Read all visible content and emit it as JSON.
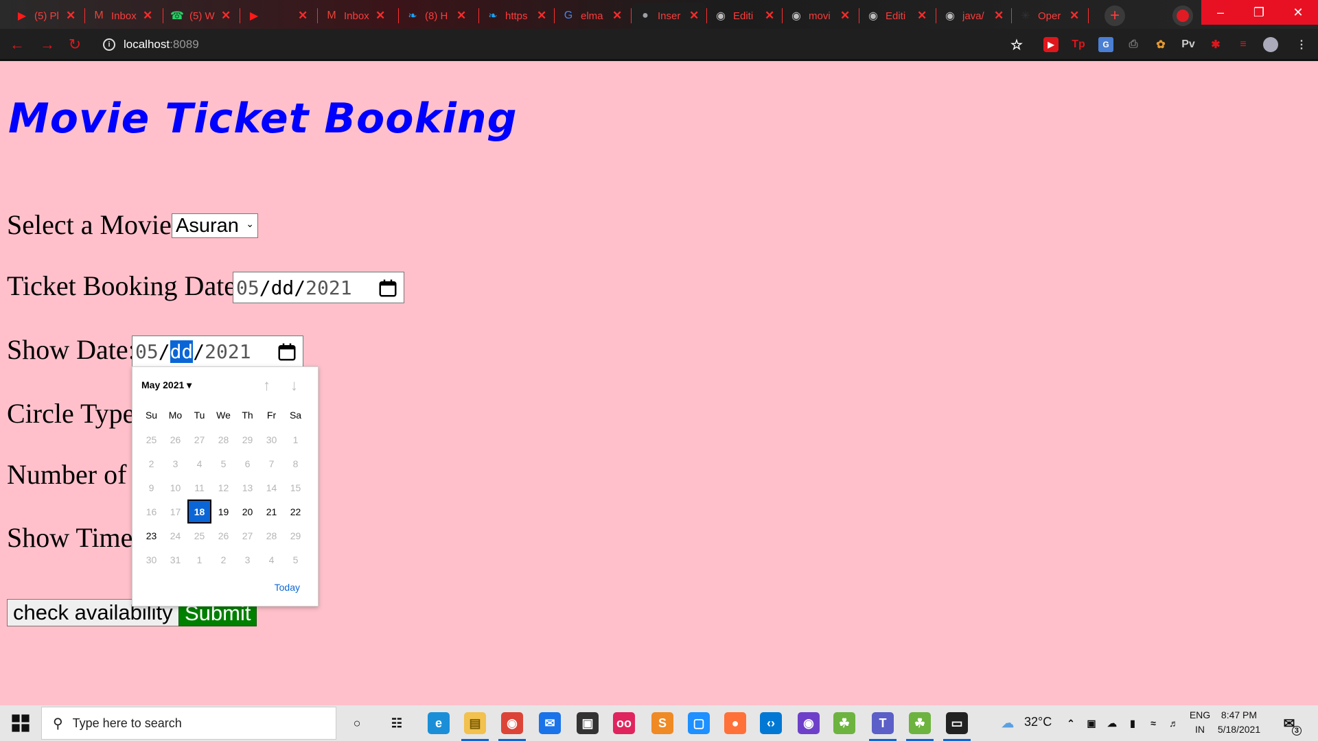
{
  "browser": {
    "tabs": [
      {
        "favicon": "youtube-icon",
        "title": "(5) Pl",
        "active": false
      },
      {
        "favicon": "gmail-icon",
        "title": "Inbox",
        "active": false
      },
      {
        "favicon": "whatsapp-icon",
        "title": "(5) W",
        "active": false
      },
      {
        "favicon": "youtube-icon",
        "title": "",
        "active": false
      },
      {
        "favicon": "gmail-icon",
        "title": "Inbox",
        "active": false
      },
      {
        "favicon": "twitter-icon",
        "title": "(8) H",
        "active": false
      },
      {
        "favicon": "twitter-icon",
        "title": "https",
        "active": false
      },
      {
        "favicon": "google-icon",
        "title": "elma",
        "active": false
      },
      {
        "favicon": "globe-icon",
        "title": "Inser",
        "active": true
      },
      {
        "favicon": "github-icon",
        "title": "Editi",
        "active": false
      },
      {
        "favicon": "github-icon",
        "title": "movi",
        "active": false
      },
      {
        "favicon": "github-icon",
        "title": "Editi",
        "active": false
      },
      {
        "favicon": "github-icon",
        "title": "java/",
        "active": false
      },
      {
        "favicon": "openai-icon",
        "title": "Oper",
        "active": false
      }
    ],
    "address": {
      "host": "localhost",
      "port": ":8089"
    },
    "extensions": [
      "Tp",
      "Pv"
    ],
    "accent_color": "#e0161d"
  },
  "page": {
    "title": "Movie Ticket Booking",
    "labels": {
      "movie": "Select a Movie:",
      "booking_date": "Ticket Booking Date:",
      "show_date": "Show Date:",
      "circle": "Circle Type:",
      "tickets": "Number of T",
      "show_time": "Show Time:"
    },
    "movie_selected": "Asuran",
    "booking_date": {
      "mm": "05",
      "dd": "dd",
      "yyyy": "2021",
      "sep": "/"
    },
    "show_date": {
      "mm": "05",
      "dd": "dd",
      "yyyy": "2021",
      "sep": "/"
    },
    "buttons": {
      "check": "check availability",
      "submit": "Submit"
    },
    "title_color": "#0000ff",
    "background": "#ffc0cb"
  },
  "calendar": {
    "month_label": "May 2021",
    "weekdays": [
      "Su",
      "Mo",
      "Tu",
      "We",
      "Th",
      "Fr",
      "Sa"
    ],
    "weeks": [
      [
        "25",
        "26",
        "27",
        "28",
        "29",
        "30",
        "1"
      ],
      [
        "2",
        "3",
        "4",
        "5",
        "6",
        "7",
        "8"
      ],
      [
        "9",
        "10",
        "11",
        "12",
        "13",
        "14",
        "15"
      ],
      [
        "16",
        "17",
        "18",
        "19",
        "20",
        "21",
        "22"
      ],
      [
        "23",
        "24",
        "25",
        "26",
        "27",
        "28",
        "29"
      ],
      [
        "30",
        "31",
        "1",
        "2",
        "3",
        "4",
        "5"
      ]
    ],
    "enabled_from": {
      "week": 3,
      "day": 2
    },
    "enabled_to": {
      "week": 4,
      "day": 0
    },
    "selected": "18",
    "today_label": "Today"
  },
  "taskbar": {
    "search_placeholder": "Type here to search",
    "weather": "32°C",
    "lang_1": "ENG",
    "lang_2": "IN",
    "time": "8:47 PM",
    "date": "5/18/2021",
    "notification_count": "3",
    "apps": [
      "cortana",
      "task-view",
      "edge",
      "file-explorer",
      "chrome",
      "mail",
      "store",
      "app-oo",
      "sublime",
      "app-blue",
      "firefox",
      "vscode",
      "github-desktop",
      "spring",
      "teams",
      "spring-2",
      "mysql"
    ]
  }
}
